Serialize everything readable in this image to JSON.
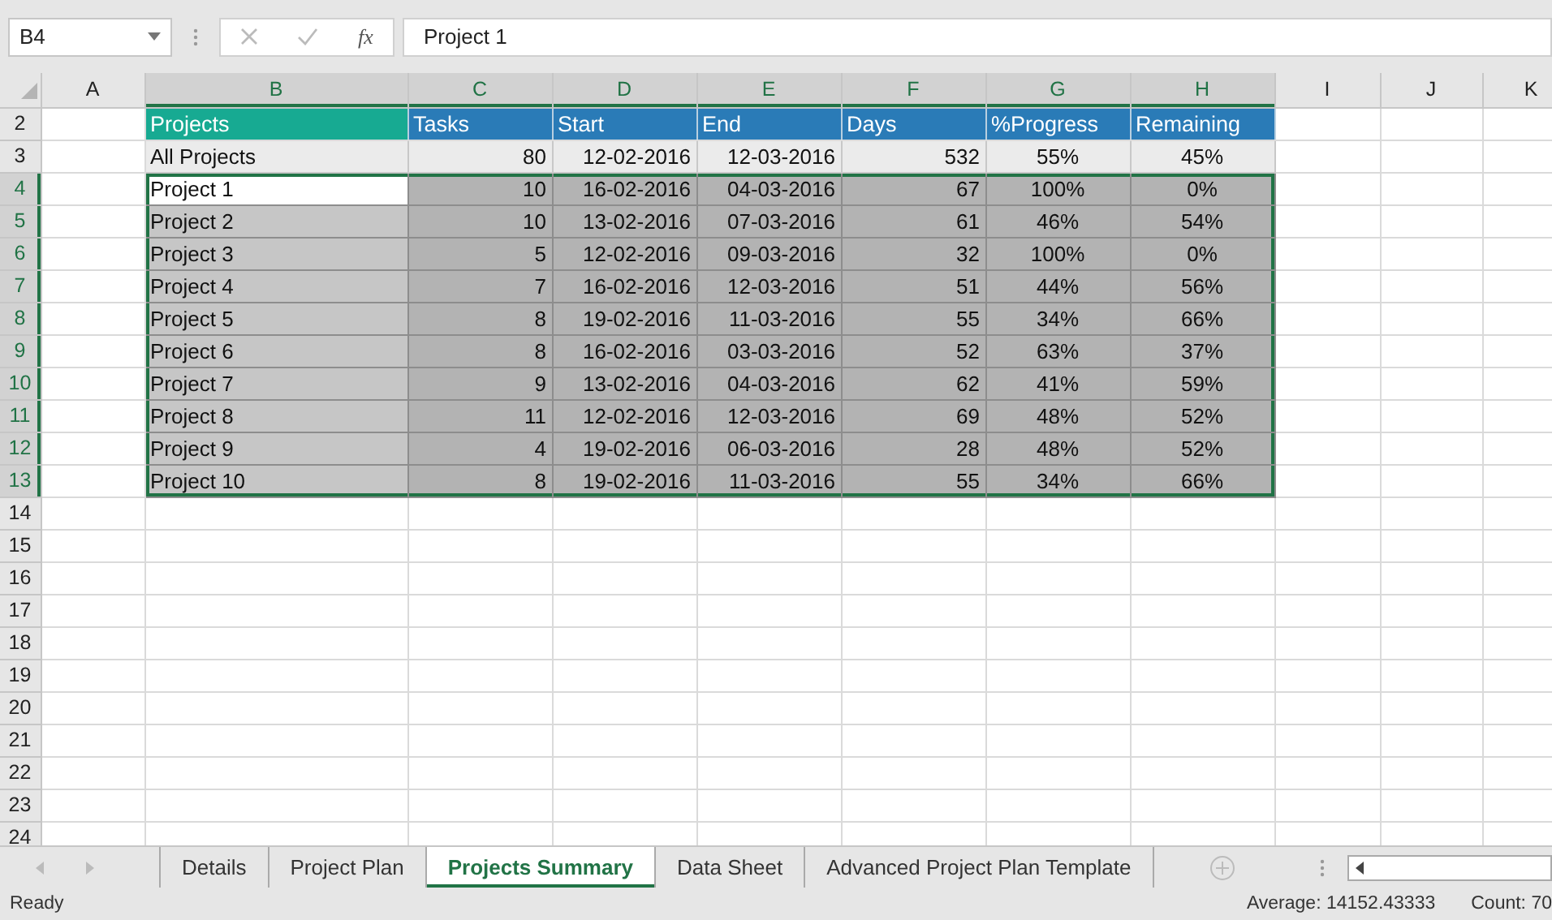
{
  "name_box": "B4",
  "function_label": "fx",
  "formula": "Project 1",
  "columns": [
    {
      "letter": "A",
      "selected": false
    },
    {
      "letter": "B",
      "selected": true
    },
    {
      "letter": "C",
      "selected": true
    },
    {
      "letter": "D",
      "selected": true
    },
    {
      "letter": "E",
      "selected": true
    },
    {
      "letter": "F",
      "selected": true
    },
    {
      "letter": "G",
      "selected": true
    },
    {
      "letter": "H",
      "selected": true
    },
    {
      "letter": "I",
      "selected": false
    },
    {
      "letter": "J",
      "selected": false
    },
    {
      "letter": "K",
      "selected": false
    }
  ],
  "header_row": {
    "row": "2",
    "cells": [
      "Projects",
      "Tasks",
      "Start",
      "End",
      "Days",
      "%Progress",
      "Remaining"
    ]
  },
  "summary_row": {
    "row": "3",
    "cells": [
      "All Projects",
      "80",
      "12-02-2016",
      "12-03-2016",
      "532",
      "55%",
      "45%"
    ]
  },
  "rows": [
    {
      "row": "4",
      "selected": true,
      "active": true,
      "cells": [
        "Project 1",
        "10",
        "16-02-2016",
        "04-03-2016",
        "67",
        "100%",
        "0%"
      ]
    },
    {
      "row": "5",
      "selected": true,
      "active": false,
      "cells": [
        "Project 2",
        "10",
        "13-02-2016",
        "07-03-2016",
        "61",
        "46%",
        "54%"
      ]
    },
    {
      "row": "6",
      "selected": true,
      "active": false,
      "cells": [
        "Project 3",
        "5",
        "12-02-2016",
        "09-03-2016",
        "32",
        "100%",
        "0%"
      ]
    },
    {
      "row": "7",
      "selected": true,
      "active": false,
      "cells": [
        "Project 4",
        "7",
        "16-02-2016",
        "12-03-2016",
        "51",
        "44%",
        "56%"
      ]
    },
    {
      "row": "8",
      "selected": true,
      "active": false,
      "cells": [
        "Project 5",
        "8",
        "19-02-2016",
        "11-03-2016",
        "55",
        "34%",
        "66%"
      ]
    },
    {
      "row": "9",
      "selected": true,
      "active": false,
      "cells": [
        "Project 6",
        "8",
        "16-02-2016",
        "03-03-2016",
        "52",
        "63%",
        "37%"
      ]
    },
    {
      "row": "10",
      "selected": true,
      "active": false,
      "cells": [
        "Project 7",
        "9",
        "13-02-2016",
        "04-03-2016",
        "62",
        "41%",
        "59%"
      ]
    },
    {
      "row": "11",
      "selected": true,
      "active": false,
      "cells": [
        "Project 8",
        "11",
        "12-02-2016",
        "12-03-2016",
        "69",
        "48%",
        "52%"
      ]
    },
    {
      "row": "12",
      "selected": true,
      "active": false,
      "cells": [
        "Project 9",
        "4",
        "19-02-2016",
        "06-03-2016",
        "28",
        "48%",
        "52%"
      ]
    },
    {
      "row": "13",
      "selected": true,
      "active": false,
      "cells": [
        "Project 10",
        "8",
        "19-02-2016",
        "11-03-2016",
        "55",
        "34%",
        "66%"
      ]
    }
  ],
  "empty_rows": [
    "14",
    "15",
    "16",
    "17",
    "18",
    "19",
    "20",
    "21",
    "22",
    "23",
    "24"
  ],
  "sheet_tabs": [
    {
      "label": "Details",
      "selected": false
    },
    {
      "label": "Project Plan",
      "selected": false
    },
    {
      "label": "Projects Summary",
      "selected": true
    },
    {
      "label": "Data Sheet",
      "selected": false
    },
    {
      "label": "Advanced Project Plan Template",
      "selected": false
    }
  ],
  "status": "Ready",
  "average": "Average: 14152.43333",
  "count": "Count: 70"
}
